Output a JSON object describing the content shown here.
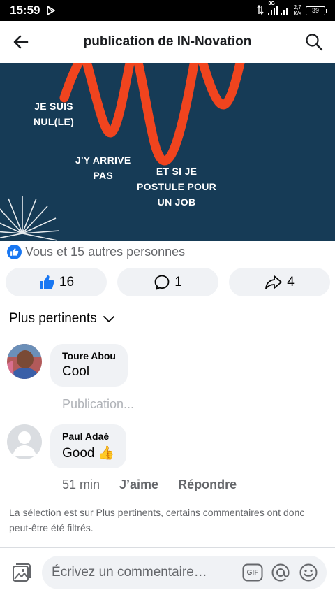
{
  "status_bar": {
    "time": "15:59",
    "network": "3G",
    "speed_value": "2,7",
    "speed_unit": "K/s",
    "battery": "39"
  },
  "header": {
    "title": "publication de IN-Novation"
  },
  "post_image": {
    "texts": [
      "JE SUIS\nNUL(LE)",
      "J'Y ARRIVE\nPAS",
      "ET SI JE\nPOSTULE POUR\nUN JOB"
    ],
    "background": "#163b56",
    "accent": "#f0441e"
  },
  "reactions": {
    "summary": "Vous et 15 autres personnes"
  },
  "actions": {
    "likes": "16",
    "comments": "1",
    "shares": "4"
  },
  "sort": {
    "label": "Plus pertinents"
  },
  "comments": [
    {
      "author": "Toure Abou",
      "text": "Cool"
    },
    {
      "author": "Paul Adaé",
      "text": "Good 👍"
    }
  ],
  "pending_label": "Publication...",
  "comment_meta": {
    "time": "51 min",
    "like": "J’aime",
    "reply": "Répondre"
  },
  "filter_note": "La sélection est sur Plus pertinents, certains commentaires ont donc peut-être été filtrés.",
  "composer": {
    "placeholder": "Écrivez un commentaire…",
    "gif_label": "GIF"
  },
  "colors": {
    "brand": "#1877f2",
    "pill": "#f0f2f5",
    "muted": "#65676b"
  }
}
